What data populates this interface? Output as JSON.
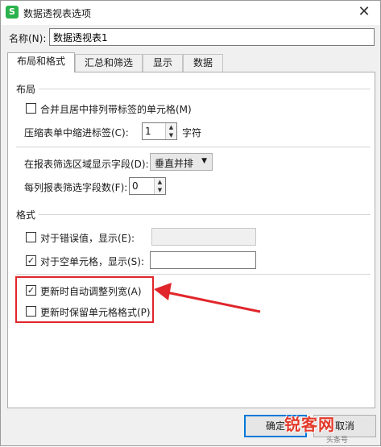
{
  "window": {
    "title": "数据透视表选项",
    "app_icon_glyph": "S",
    "close_glyph": "✕"
  },
  "name": {
    "label": "名称(N):",
    "value": "数据透视表1"
  },
  "tabs": [
    {
      "label": "布局和格式",
      "active": true
    },
    {
      "label": "汇总和筛选",
      "active": false
    },
    {
      "label": "显示",
      "active": false
    },
    {
      "label": "数据",
      "active": false
    }
  ],
  "layout": {
    "group_label": "布局",
    "merge_center": {
      "label": "合并且居中排列带标签的单元格(M)",
      "checked": false
    },
    "indent": {
      "label": "压缩表单中缩进标签(C):",
      "value": "1",
      "unit": "字符"
    },
    "filter_area": {
      "label": "在报表筛选区域显示字段(D):",
      "value": "垂直并排"
    },
    "fields_per_column": {
      "label": "每列报表筛选字段数(F):",
      "value": "0"
    }
  },
  "format": {
    "group_label": "格式",
    "error_values": {
      "label": "对于错误值，显示(E):",
      "checked": false,
      "value": ""
    },
    "empty_cells": {
      "label": "对于空单元格，显示(S):",
      "checked": true,
      "value": ""
    },
    "autofit": {
      "label": "更新时自动调整列宽(A)",
      "checked": true
    },
    "preserve_format": {
      "label": "更新时保留单元格格式(P)",
      "checked": false
    }
  },
  "buttons": {
    "ok": "确定",
    "cancel": "取消"
  },
  "watermark": {
    "text": "锐客网",
    "sub": "头条号"
  },
  "colors": {
    "highlight": "#e0262b",
    "accent": "#0078d7",
    "app_icon": "#2bb24c"
  }
}
